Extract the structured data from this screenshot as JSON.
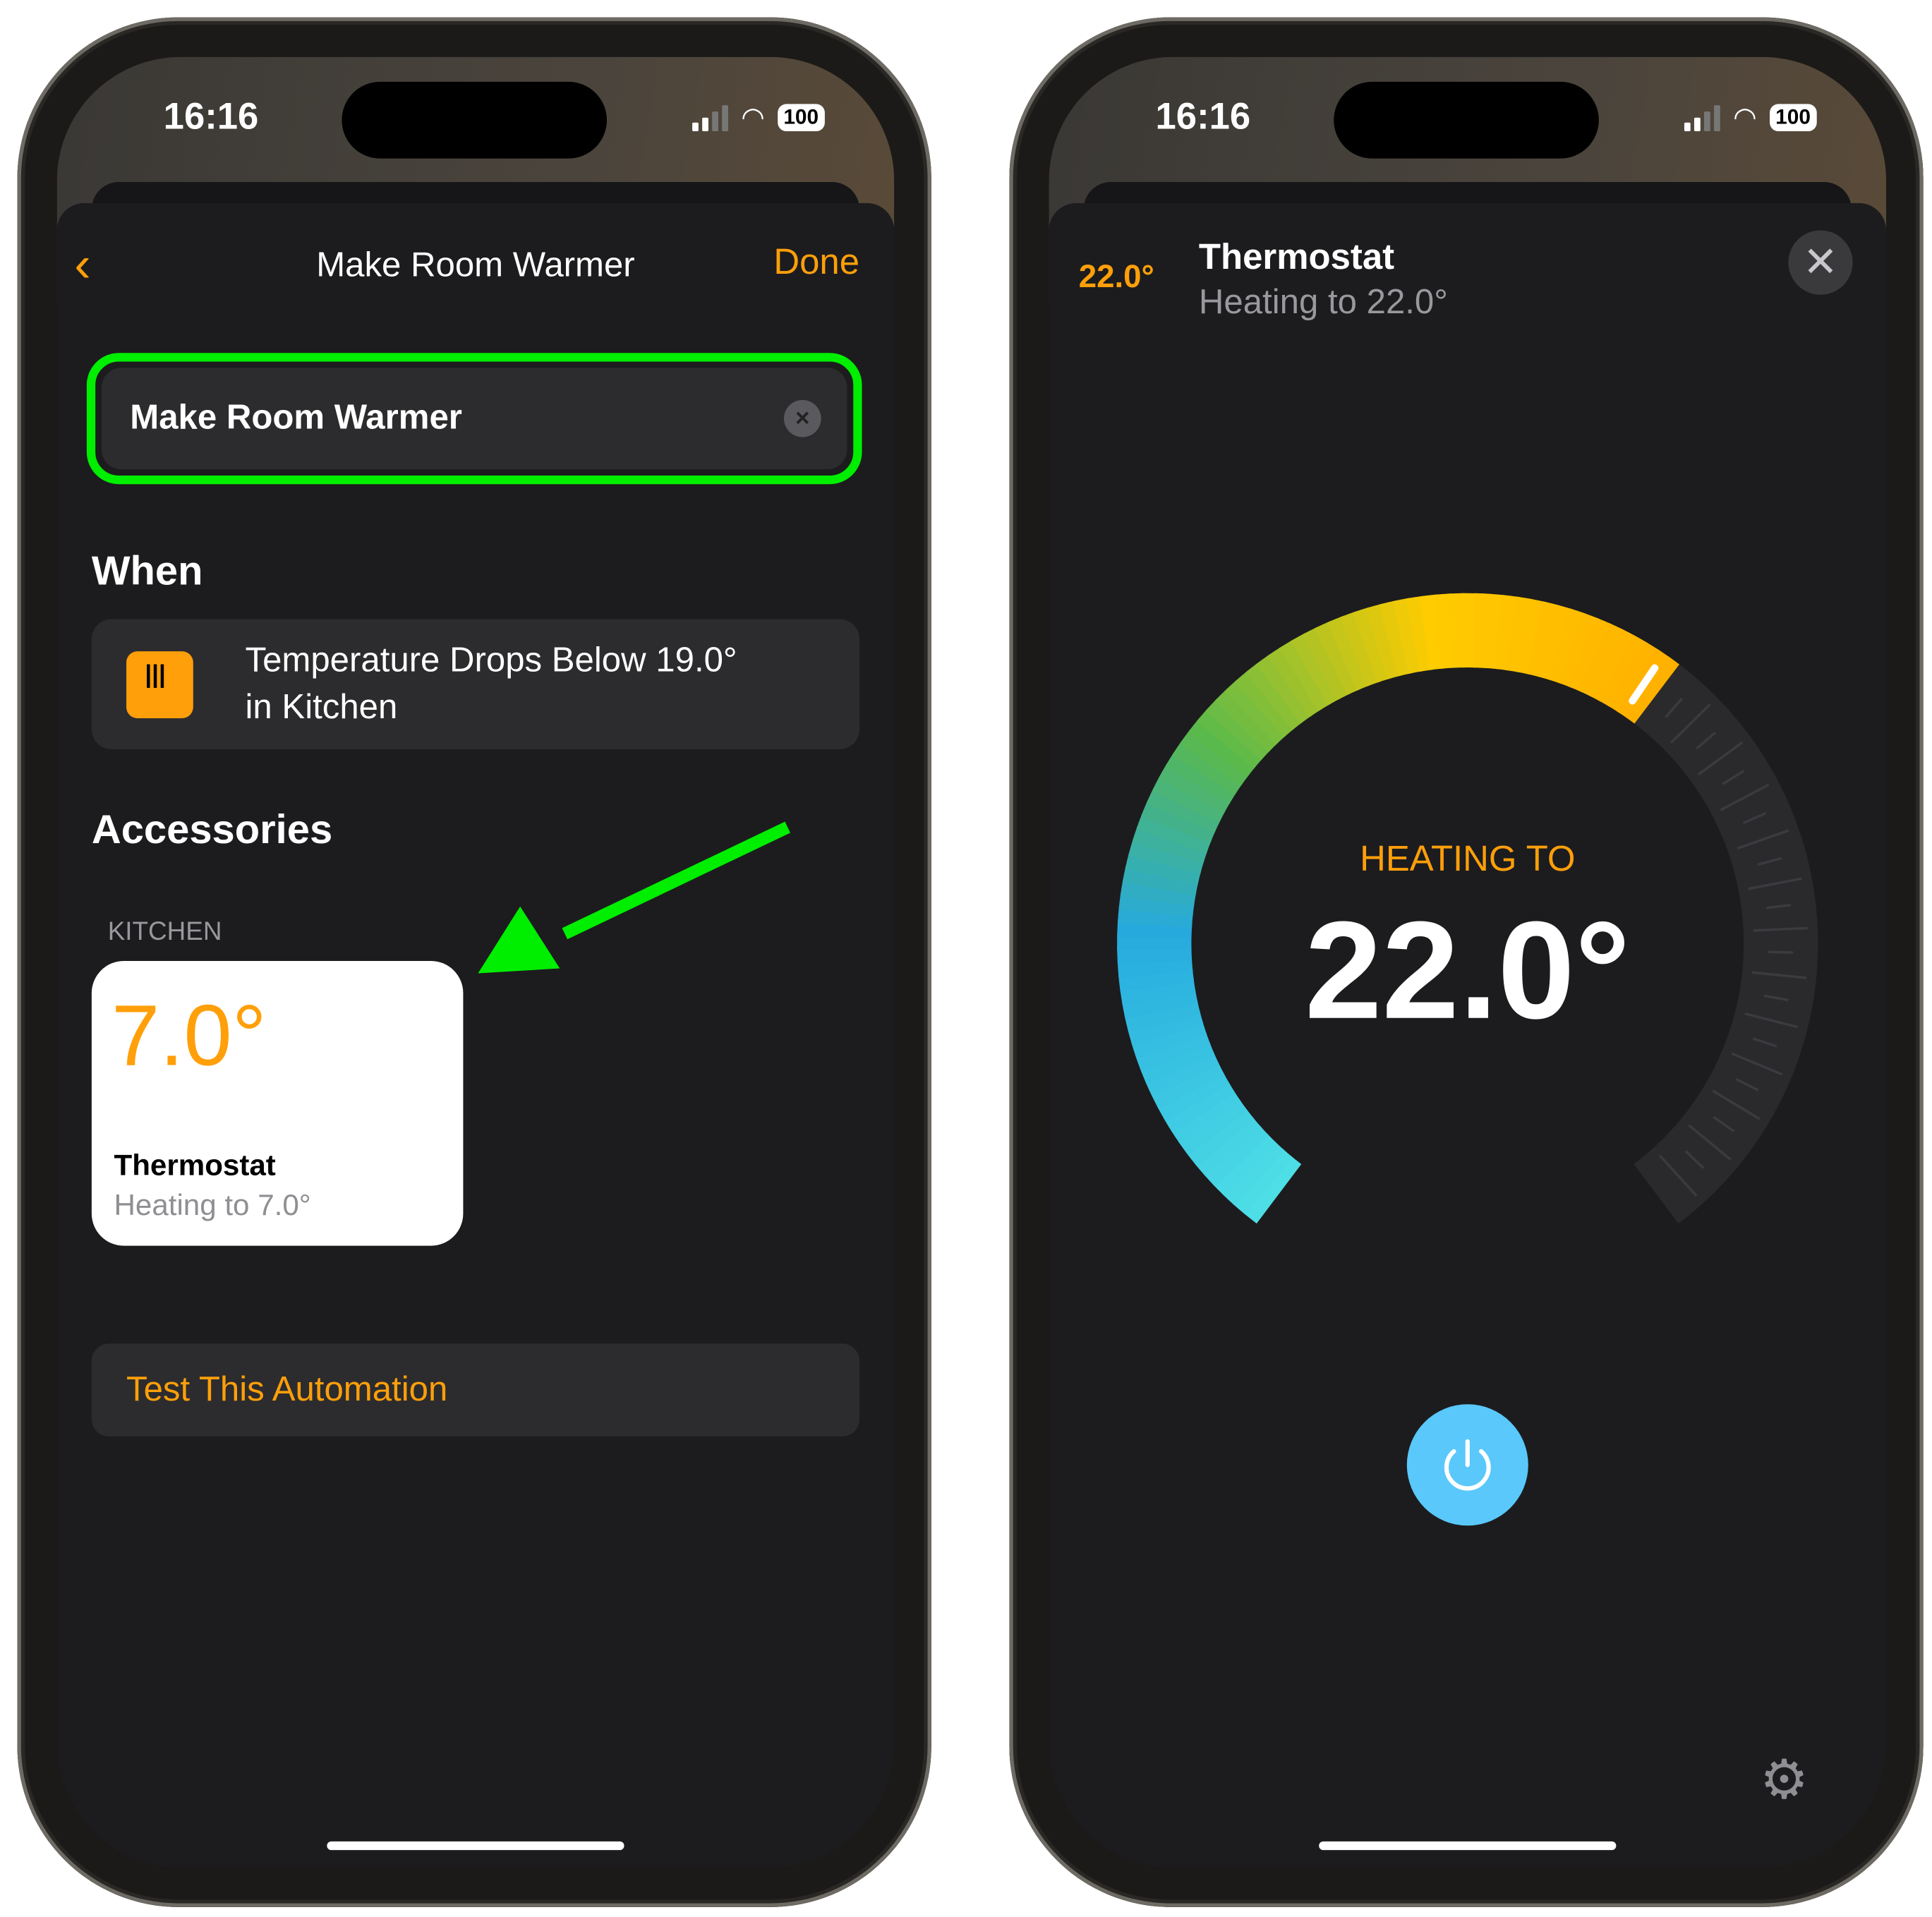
{
  "left": {
    "status": {
      "time": "16:16",
      "battery": "100"
    },
    "nav": {
      "back_icon": "chevron-left-icon",
      "title": "Make Room Warmer",
      "done_label": "Done"
    },
    "name_field": {
      "value": "Make Room Warmer",
      "clear_icon": "xmark-circle-icon"
    },
    "when": {
      "heading": "When",
      "trigger_line1": "Temperature Drops Below 19.0°",
      "trigger_line2": "in Kitchen",
      "icon": "thermostat-icon"
    },
    "accessories": {
      "heading": "Accessories",
      "room": "KITCHEN",
      "tile": {
        "value": "7.0°",
        "name": "Thermostat",
        "status": "Heating to 7.0°"
      }
    },
    "test_label": "Test This Automation"
  },
  "right": {
    "status": {
      "time": "16:16",
      "battery": "100"
    },
    "header": {
      "current": "22.0°",
      "name": "Thermostat",
      "status": "Heating to 22.0°",
      "close_icon": "xmark-icon"
    },
    "dial": {
      "label": "HEATING TO",
      "value": "22.0°",
      "fraction": 0.63
    },
    "power_icon": "power-icon",
    "settings_icon": "gear-icon"
  },
  "colors": {
    "accent": "#ff9f0a",
    "highlight": "#00ee00",
    "power": "#5ac8fa"
  }
}
